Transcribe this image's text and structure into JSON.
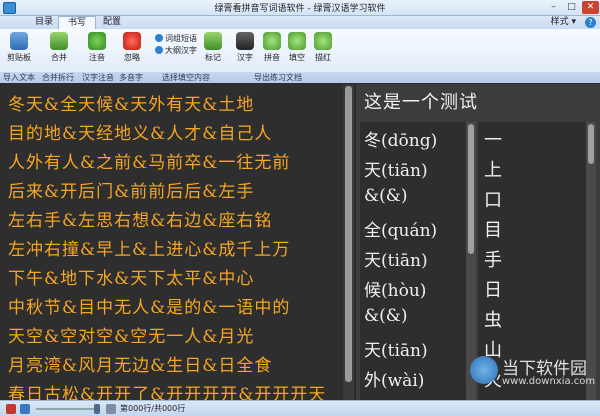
{
  "window": {
    "title": "绿膏看拼音写词语软件 - 绿膏汉语学习软件",
    "min": "–",
    "max": "□",
    "close": "✕"
  },
  "tabs": [
    {
      "label": "目录"
    },
    {
      "label": "书写"
    },
    {
      "label": "配置"
    }
  ],
  "style_menu": "样式 ▾",
  "help": "?",
  "ribbon": {
    "paste_label": "剪贴板",
    "merge_label": "合并",
    "note_label": "注音",
    "skip_label": "忽略",
    "check_words": "词组短语",
    "check_big": "大纲汉字",
    "mark_label": "标记",
    "hanzi_label": "汉字",
    "pinyin_label": "拼音",
    "fill_label": "填空",
    "pause_label": "描红",
    "groups": [
      "导入文本",
      "合并拆行",
      "汉字注音",
      "多音字",
      "选择填空内容",
      "导出练习文档"
    ]
  },
  "left_text": [
    "冬天&全天候&天外有天&土地",
    "目的地&天经地义&人才&自己人",
    "人外有人&之前&马前卒&一往无前",
    "后来&开后门&前前后后&左手",
    "左右手&左思右想&右边&座右铭",
    "左冲右撞&早上&上进心&成千上万",
    "下午&地下水&天下太平&中心",
    "中秋节&目中无人&是的&一语中的",
    "天空&空对空&空无一人&月光",
    "月亮湾&风月无边&生日&日全食",
    "春日古松&开开了&开开开开&开开开天"
  ],
  "right": {
    "title": "这是一个测试",
    "pinyin_lines": [
      "冬(dōng)",
      "天(tiān)",
      "&(&)",
      "全(quán)",
      "天(tiān)",
      "候(hòu)",
      "&(&)",
      "天(tiān)",
      "外(wài)"
    ],
    "char_lines": [
      "一",
      "上",
      "口",
      "目",
      "手",
      "日",
      "虫",
      "山",
      "火"
    ]
  },
  "watermark": {
    "text": "当下软件园",
    "url": "www.downxia.com"
  },
  "status": {
    "text": "第000行/共000行"
  },
  "colors": {
    "text_orange": "#f5a623",
    "pane_bg": "#2e2e2e",
    "ribbon_bg": "#dce9f7"
  }
}
